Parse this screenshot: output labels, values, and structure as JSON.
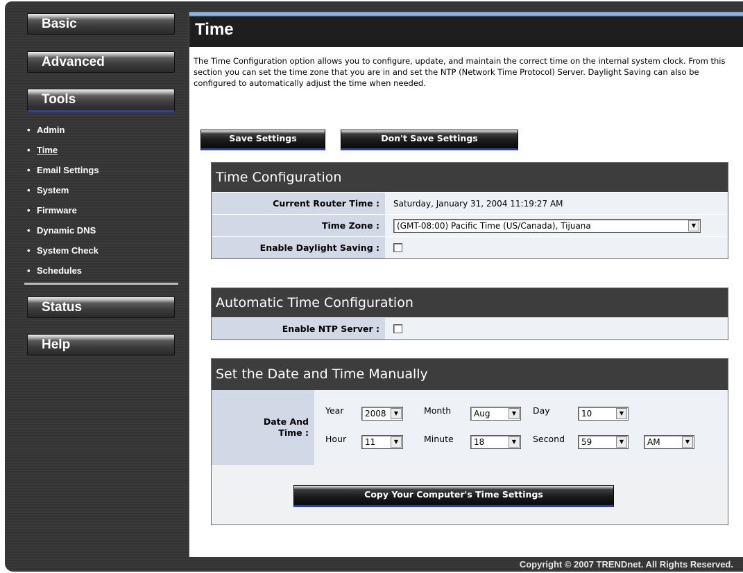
{
  "sidebar": {
    "nav": {
      "basic": "Basic",
      "advanced": "Advanced",
      "tools": "Tools",
      "status": "Status",
      "help": "Help"
    },
    "tools_items": [
      {
        "label": "Admin"
      },
      {
        "label": "Time"
      },
      {
        "label": "Email Settings"
      },
      {
        "label": "System"
      },
      {
        "label": "Firmware"
      },
      {
        "label": "Dynamic DNS"
      },
      {
        "label": "System Check"
      },
      {
        "label": "Schedules"
      }
    ],
    "bullet": "•"
  },
  "page": {
    "title": "Time",
    "intro": "The Time Configuration option allows you to configure, update, and maintain the correct time on the internal system clock. From this section you can set the time zone that you are in and set the NTP (Network Time Protocol) Server. Daylight Saving can also be configured to automatically adjust the time when needed.",
    "save_label": "Save Settings",
    "dont_save_label": "Don't Save Settings"
  },
  "time_config": {
    "heading": "Time Configuration",
    "current_time_label": "Current Router Time :",
    "current_time_value": "Saturday, January 31, 2004 11:19:27 AM",
    "time_zone_label": "Time Zone :",
    "time_zone_value": "(GMT-08:00) Pacific Time (US/Canada), Tijuana",
    "daylight_label": "Enable Daylight Saving :",
    "daylight_checked": false
  },
  "auto_time": {
    "heading": "Automatic Time Configuration",
    "ntp_label": "Enable NTP Server :",
    "ntp_checked": false
  },
  "manual": {
    "heading": "Set the Date and Time Manually",
    "date_time_label_1": "Date And",
    "date_time_label_2": "Time :",
    "year_label": "Year",
    "year_value": "2008",
    "month_label": "Month",
    "month_value": "Aug",
    "day_label": "Day",
    "day_value": "10",
    "hour_label": "Hour",
    "hour_value": "11",
    "minute_label": "Minute",
    "minute_value": "18",
    "second_label": "Second",
    "second_value": "59",
    "ampm_value": "AM",
    "copy_label": "Copy Your Computer's Time Settings"
  },
  "footer": {
    "copyright": "Copyright © 2007 TRENDnet. All Rights Reserved."
  },
  "icons": {
    "dropdown_arrow": "▼"
  }
}
